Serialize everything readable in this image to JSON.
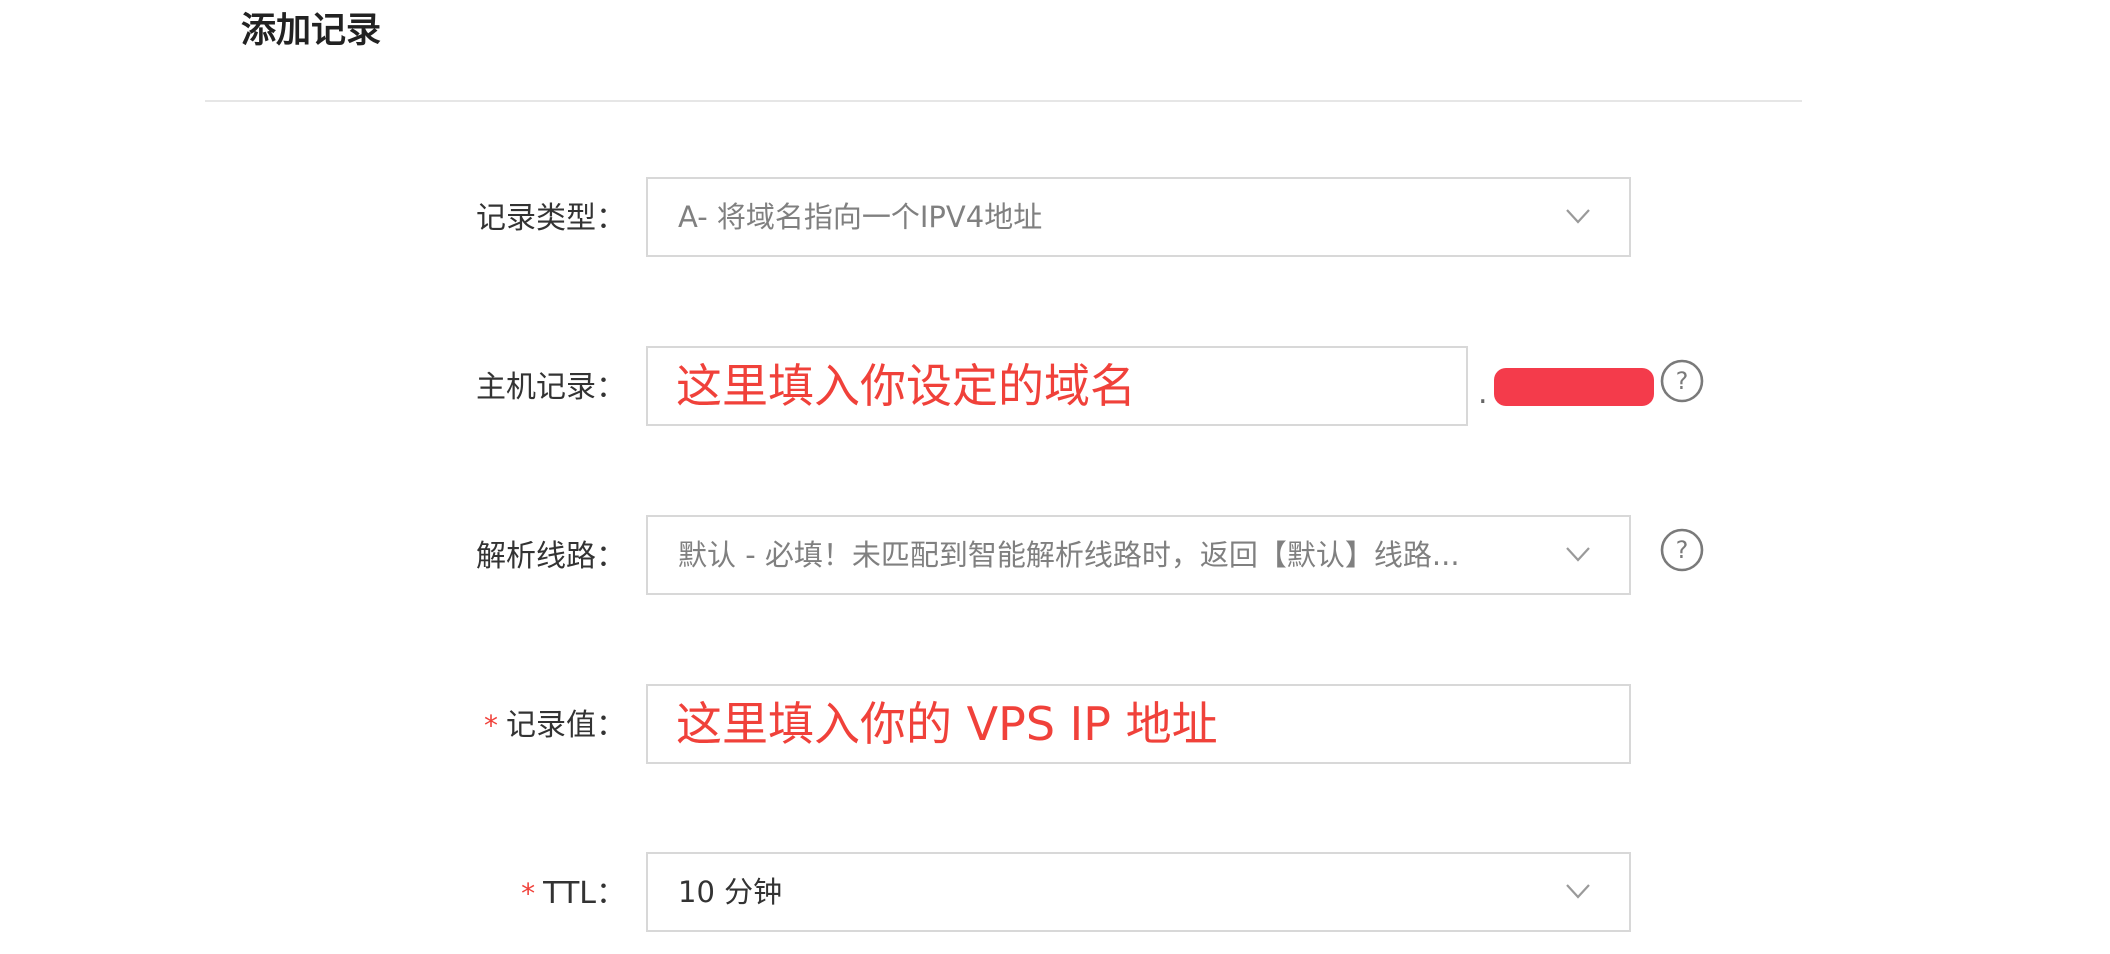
{
  "dialog": {
    "title": "添加记录"
  },
  "form": {
    "record_type": {
      "label": "记录类型：",
      "value": "A- 将域名指向一个IPV4地址"
    },
    "host_record": {
      "label": "主机记录：",
      "annotation": "这里填入你设定的域名",
      "domain_separator": "."
    },
    "resolution_line": {
      "label": "解析线路：",
      "value": "默认 - 必填！未匹配到智能解析线路时，返回【默认】线路..."
    },
    "record_value": {
      "required_mark": "*",
      "label": "记录值：",
      "annotation": "这里填入你的 VPS IP 地址"
    },
    "ttl": {
      "required_mark": "*",
      "label": "TTL：",
      "value": "10 分钟"
    }
  },
  "colors": {
    "annotation": "#f0413a",
    "redaction": "#f43b4b",
    "border": "#d8d8d8"
  },
  "icons": {
    "select_arrow": "chevron-down-icon",
    "help": "question-circle-icon"
  }
}
